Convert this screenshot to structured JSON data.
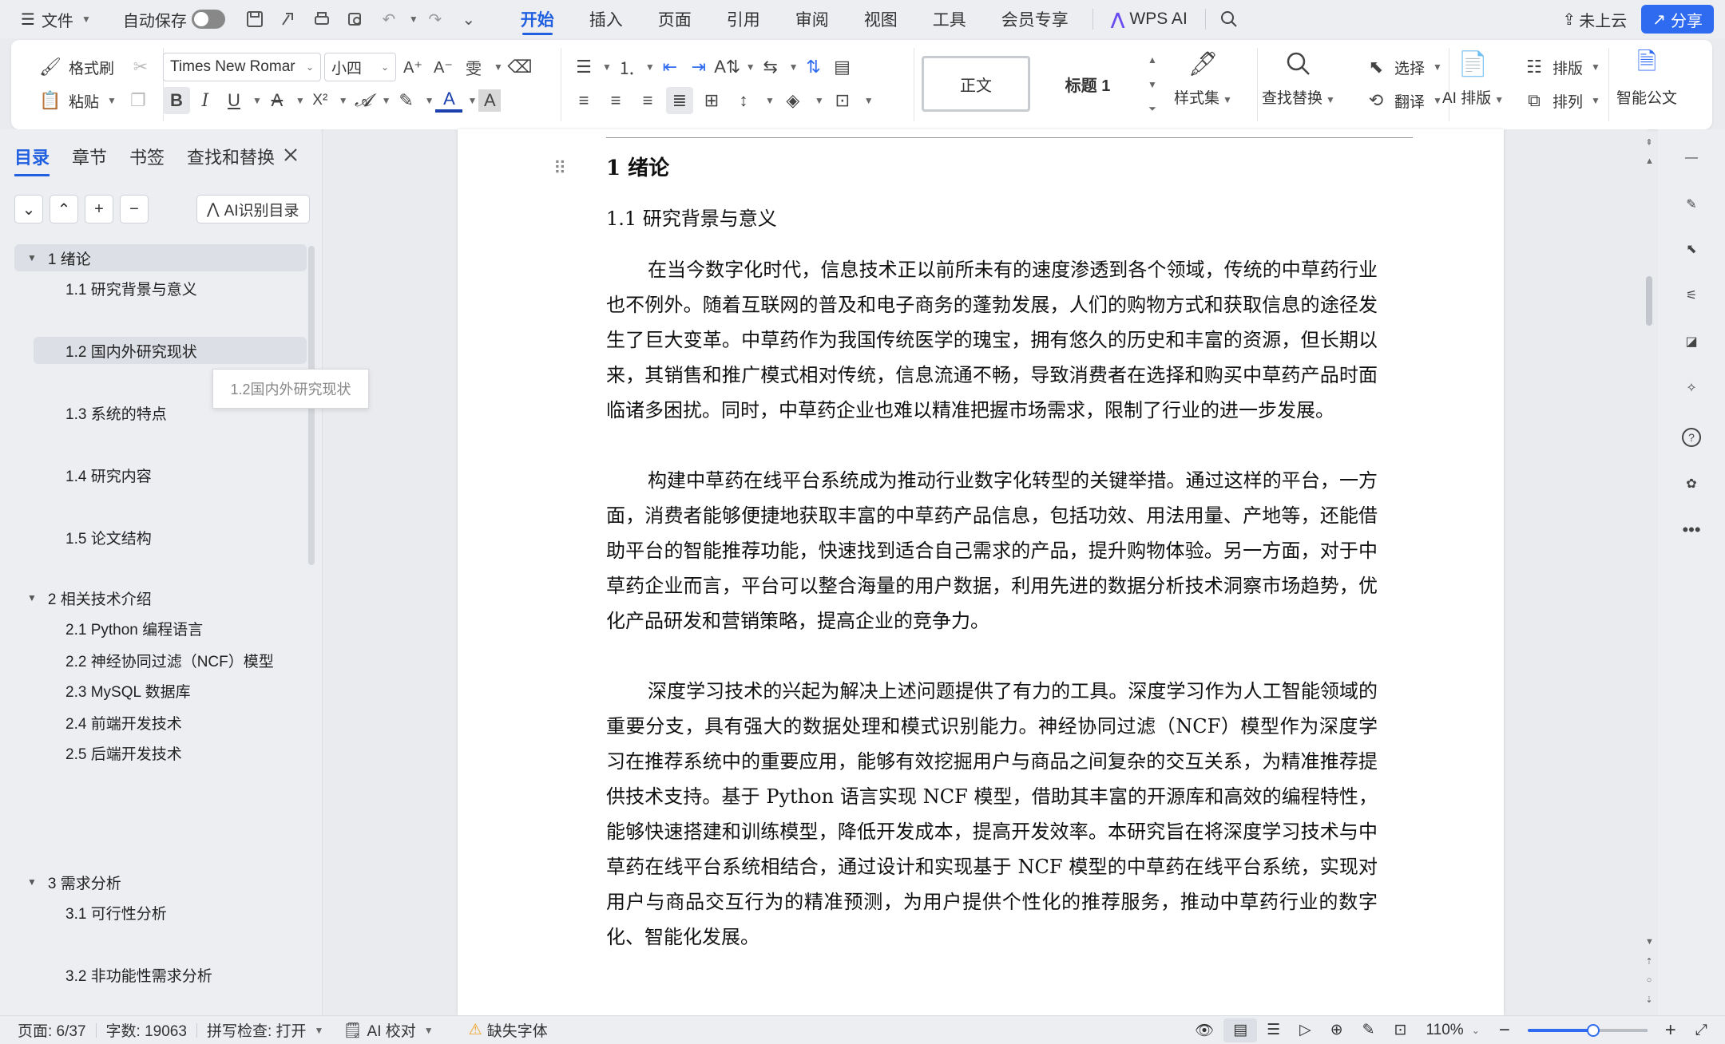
{
  "menubar": {
    "file": "文件",
    "autosave": "自动保存",
    "tabs": [
      "开始",
      "插入",
      "页面",
      "引用",
      "审阅",
      "视图",
      "工具",
      "会员专享"
    ],
    "wps_ai": "WPS AI",
    "cloud": "未上云",
    "share": "分享"
  },
  "ribbon": {
    "format_painter": "格式刷",
    "paste": "粘贴",
    "font_name": "Times New Romar",
    "font_size": "小四",
    "style_normal": "正文",
    "style_heading1": "标题 1",
    "style_set": "样式集",
    "find_replace": "查找替换",
    "select": "选择",
    "translate": "翻译",
    "ai_layout": "AI 排版",
    "typeset": "排版",
    "arrange": "排列",
    "smart_doc": "智能公文",
    "bold": "B",
    "italic": "I",
    "underline": "U",
    "strike": "A",
    "superscript": "X²",
    "font_color_letter": "A",
    "char_shade": "A",
    "pinyin": "雯",
    "grow": "A⁺",
    "shrink": "A⁻"
  },
  "nav": {
    "tabs": [
      "目录",
      "章节",
      "书签",
      "查找和替换"
    ],
    "ai_toc": "AI识别目录",
    "tooltip": "1.2国内外研究现状",
    "items": [
      {
        "label": "1  绪论",
        "level": 1
      },
      {
        "label": "1.1 研究背景与意义",
        "level": 2
      },
      {
        "label": "1.2 国内外研究现状",
        "level": 2
      },
      {
        "label": "1.3 系统的特点",
        "level": 2
      },
      {
        "label": "1.4 研究内容",
        "level": 2
      },
      {
        "label": "1.5 论文结构",
        "level": 2
      },
      {
        "label": "2  相关技术介绍",
        "level": 1
      },
      {
        "label": "2.1 Python  编程语言",
        "level": 2
      },
      {
        "label": "2.2  神经协同过滤（NCF）模型",
        "level": 2
      },
      {
        "label": "2.3 MySQL  数据库",
        "level": 2
      },
      {
        "label": "2.4  前端开发技术",
        "level": 2
      },
      {
        "label": "2.5  后端开发技术",
        "level": 2
      },
      {
        "label": "3  需求分析",
        "level": 1
      },
      {
        "label": "3.1 可行性分析",
        "level": 2
      },
      {
        "label": "3.2  非功能性需求分析",
        "level": 2
      }
    ]
  },
  "document": {
    "heading1": "1  绪论",
    "heading2": "1.1 研究背景与意义",
    "paragraphs": [
      "在当今数字化时代，信息技术正以前所未有的速度渗透到各个领域，传统的中草药行业也不例外。随着互联网的普及和电子商务的蓬勃发展，人们的购物方式和获取信息的途径发生了巨大变革。中草药作为我国传统医学的瑰宝，拥有悠久的历史和丰富的资源，但长期以来，其销售和推广模式相对传统，信息流通不畅，导致消费者在选择和购买中草药产品时面临诸多困扰。同时，中草药企业也难以精准把握市场需求，限制了行业的进一步发展。",
      "构建中草药在线平台系统成为推动行业数字化转型的关键举措。通过这样的平台，一方面，消费者能够便捷地获取丰富的中草药产品信息，包括功效、用法用量、产地等，还能借助平台的智能推荐功能，快速找到适合自己需求的产品，提升购物体验。另一方面，对于中草药企业而言，平台可以整合海量的用户数据，利用先进的数据分析技术洞察市场趋势，优化产品研发和营销策略，提高企业的竞争力。",
      "深度学习技术的兴起为解决上述问题提供了有力的工具。深度学习作为人工智能领域的重要分支，具有强大的数据处理和模式识别能力。神经协同过滤（NCF）模型作为深度学习在推荐系统中的重要应用，能够有效挖掘用户与商品之间复杂的交互关系，为精准推荐提供技术支持。基于 Python 语言实现 NCF 模型，借助其丰富的开源库和高效的编程特性，能够快速搭建和训练模型，降低开发成本，提高开发效率。本研究旨在将深度学习技术与中草药在线平台系统相结合，通过设计和实现基于 NCF 模型的中草药在线平台系统，实现对用户与商品交互行为的精准预测，为用户提供个性化的推荐服务，推动中草药行业的数字化、智能化发展。"
    ]
  },
  "status": {
    "page": "页面: 6/37",
    "words": "字数: 19063",
    "spell": "拼写检查: 打开",
    "ai_proof": "AI 校对",
    "missing_font": "缺失字体",
    "zoom": "110%",
    "zoom_fraction": 0.55
  },
  "colors": {
    "accent": "#1f5fe0",
    "share_bg": "#2f6bf0",
    "warning": "#f0a020"
  }
}
